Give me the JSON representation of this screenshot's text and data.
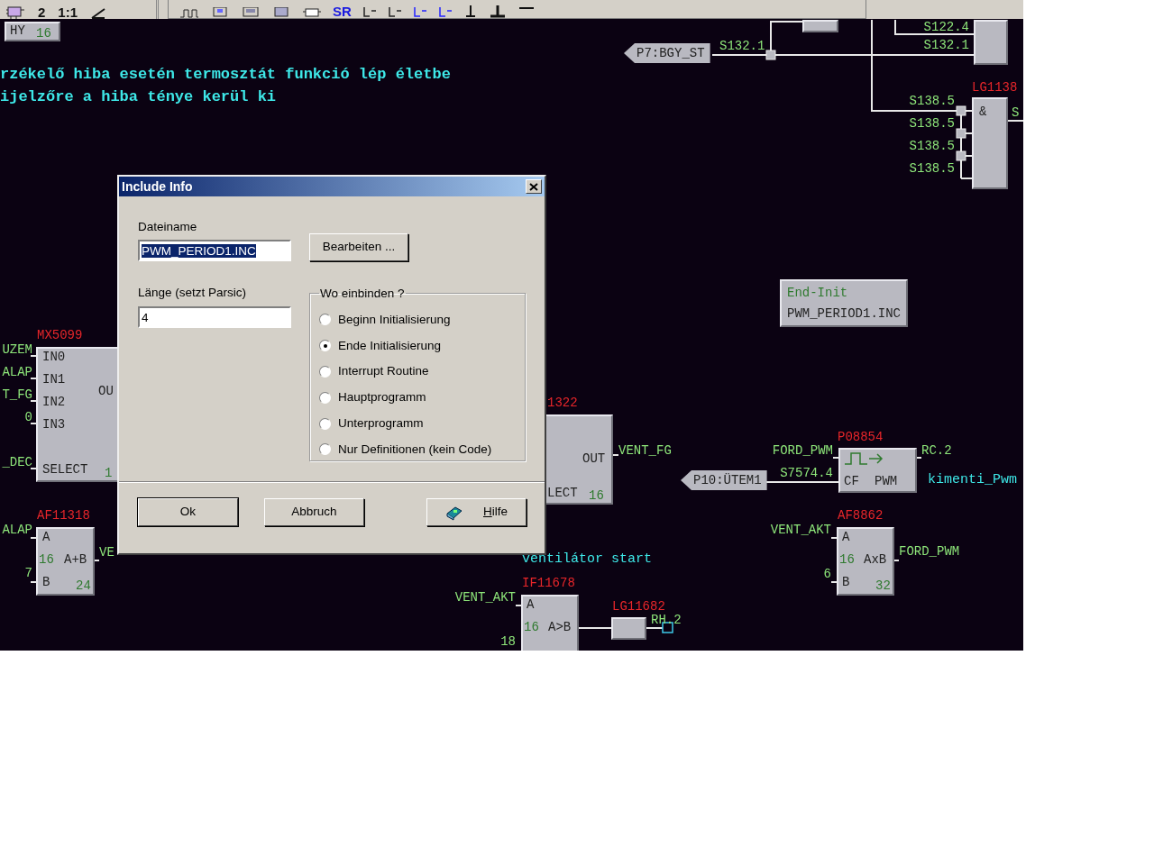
{
  "toolbar": {
    "left_items": [
      "2",
      "1:1"
    ],
    "right_items": [
      "SR"
    ]
  },
  "canvas": {
    "comments": [
      "rzékelő hiba esetén termosztát funkció lép életbe",
      "ijelzőre a hiba ténye kerül ki",
      "ventilátor start",
      "kimenti_Pwm"
    ],
    "tags": [
      {
        "text": "P7:BGY_ST",
        "output": "S132.1"
      },
      {
        "text": "P10:ÜTEM1"
      }
    ],
    "info_box": {
      "lines": [
        "End-Init",
        "PWM_PERIOD1.INC"
      ]
    },
    "blocks": [
      {
        "kind": "block",
        "pins": [
          {
            "text": "HY",
            "kind": "pin"
          },
          {
            "text": "16",
            "kind": "value"
          }
        ]
      },
      {
        "kind": "block"
      },
      {
        "kind": "block",
        "inputs": [
          "S122.4",
          "S132.1"
        ]
      },
      {
        "kind": "block",
        "id": "LG1138",
        "pins": [
          {
            "text": "&",
            "kind": "pin"
          }
        ],
        "inputs": [
          "S138.5",
          "S138.5",
          "S138.5",
          "S138.5"
        ],
        "outputs": [
          "S"
        ]
      },
      {
        "kind": "block",
        "id": "MX5099",
        "pins": [
          {
            "text": "IN0",
            "kind": "pin"
          },
          {
            "text": "IN1",
            "kind": "pin"
          },
          {
            "text": "IN2",
            "kind": "pin"
          },
          {
            "text": "IN3",
            "kind": "pin"
          },
          {
            "text": "SELECT",
            "kind": "pin"
          },
          {
            "text": "OU",
            "kind": "pin"
          },
          {
            "text": "1",
            "kind": "value"
          }
        ],
        "inputs": [
          "UZEM",
          "ALAP",
          "T_FG",
          "0",
          "_DEC"
        ]
      },
      {
        "kind": "block",
        "id": "AF11318",
        "pins": [
          {
            "text": "A",
            "kind": "pin"
          },
          {
            "text": "16",
            "kind": "value"
          },
          {
            "text": "A+B",
            "kind": "pin"
          },
          {
            "text": "B",
            "kind": "pin"
          },
          {
            "text": "24",
            "kind": "value"
          }
        ],
        "inputs": [
          "ALAP",
          "7"
        ],
        "outputs": [
          "VE"
        ]
      },
      {
        "kind": "block",
        "id": "1322",
        "pins": [
          {
            "text": "OUT",
            "kind": "pin"
          },
          {
            "text": "LECT",
            "kind": "pin"
          },
          {
            "text": "16",
            "kind": "value"
          }
        ],
        "outputs": [
          "VENT_FG"
        ]
      },
      {
        "kind": "block",
        "id": "P08854",
        "pins": [
          {
            "kind": "pulse"
          },
          {
            "text": "CF",
            "kind": "pin"
          },
          {
            "text": "PWM",
            "kind": "pin"
          }
        ],
        "inputs": [
          "FORD_PWM",
          "S7574.4"
        ],
        "outputs": [
          "RC.2"
        ]
      },
      {
        "kind": "block",
        "id": "AF8862",
        "pins": [
          {
            "text": "A",
            "kind": "pin"
          },
          {
            "text": "16",
            "kind": "value"
          },
          {
            "text": "AxB",
            "kind": "pin"
          },
          {
            "text": "B",
            "kind": "pin"
          },
          {
            "text": "32",
            "kind": "value"
          }
        ],
        "inputs": [
          "VENT_AKT",
          "6"
        ],
        "outputs": [
          "FORD_PWM"
        ]
      },
      {
        "kind": "block",
        "id": "IF11678",
        "pins": [
          {
            "text": "A",
            "kind": "pin"
          },
          {
            "text": "16",
            "kind": "value"
          },
          {
            "text": "A>B",
            "kind": "pin"
          }
        ],
        "inputs": [
          "VENT_AKT",
          "18"
        ]
      },
      {
        "kind": "block",
        "id": "LG11682",
        "outputs": [
          "RH.2"
        ]
      }
    ]
  },
  "dialog": {
    "title": "Include Info",
    "filename": {
      "label": "Dateiname",
      "value": "PWM_PERIOD1.INC",
      "highlighted": true
    },
    "edit_button": "Bearbeiten ...",
    "length": {
      "label": "Länge (setzt Parsic)",
      "value": "4"
    },
    "group": {
      "label": "Wo einbinden ?",
      "options": [
        {
          "label": "Beginn Initialisierung",
          "selected": false
        },
        {
          "label": "Ende Initialisierung",
          "selected": true
        },
        {
          "label": "Interrupt Routine",
          "selected": false
        },
        {
          "label": "Hauptprogramm",
          "selected": false
        },
        {
          "label": "Unterprogramm",
          "selected": false
        },
        {
          "label": "Nur Definitionen (kein Code)",
          "selected": false
        }
      ]
    },
    "buttons": [
      {
        "label": "Ok",
        "kind": "default"
      },
      {
        "label": "Abbruch",
        "kind": "plain"
      },
      {
        "label": "Hilfe",
        "kind": "help"
      }
    ]
  }
}
